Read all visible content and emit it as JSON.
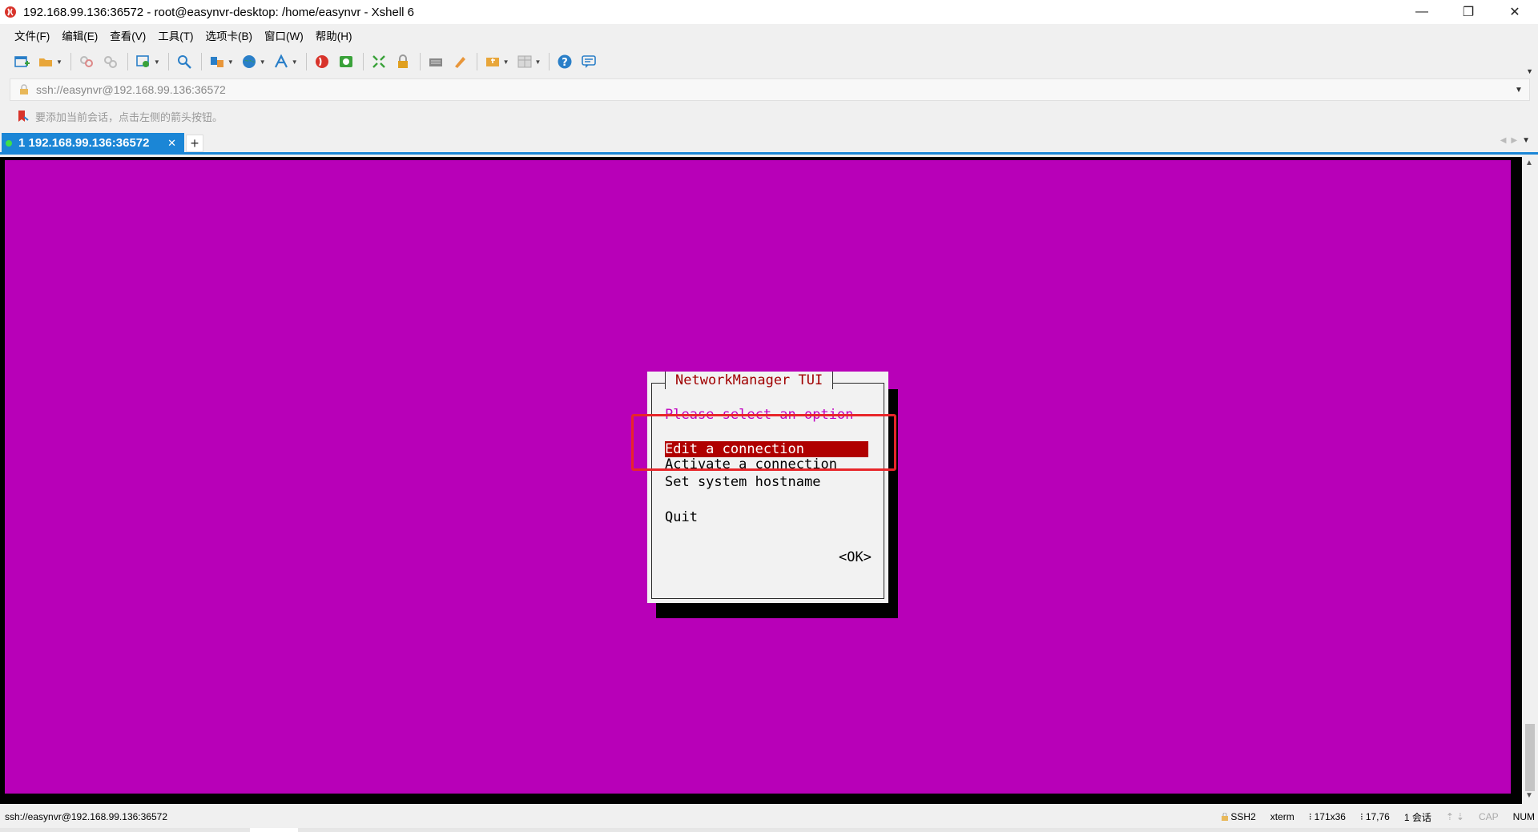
{
  "window": {
    "title": "192.168.99.136:36572 - root@easynvr-desktop: /home/easynvr - Xshell 6",
    "min_glyph": "—",
    "restore_glyph": "❐",
    "close_glyph": "✕"
  },
  "menu": {
    "items": [
      "文件(F)",
      "编辑(E)",
      "查看(V)",
      "工具(T)",
      "选项卡(B)",
      "窗口(W)",
      "帮助(H)"
    ]
  },
  "toolbar": {
    "icons": [
      "new-session-icon",
      "open-folder-icon",
      "connect-icon",
      "disconnect-icon",
      "properties-icon",
      "find-icon",
      "transfer-icon",
      "globe-icon",
      "font-icon",
      "xshell-icon",
      "xftp-icon",
      "fullscreen-icon",
      "lock-icon",
      "keyboard-icon",
      "compose-icon",
      "script-icon",
      "layout-icon",
      "help-icon",
      "chat-icon"
    ],
    "colors": {
      "blue": "#1b86d6",
      "green": "#3aa23a",
      "red": "#d8342b",
      "orange": "#e8963a"
    }
  },
  "address": {
    "value": "ssh://easynvr@192.168.99.136:36572"
  },
  "hint": {
    "text": "要添加当前会话，点击左侧的箭头按钮。"
  },
  "tabs": [
    {
      "label": "1 192.168.99.136:36572",
      "active": true
    }
  ],
  "tab_add_glyph": "+",
  "terminal": {
    "background": "#b800b8",
    "dialog": {
      "title": "NetworkManager TUI",
      "prompt": "Please select an option",
      "options": [
        "Edit a connection",
        "Activate a connection",
        "Set system hostname",
        "Quit"
      ],
      "selected_option": "Edit a connection",
      "ok_label": "<OK>"
    }
  },
  "statusbar": {
    "left": "ssh://easynvr@192.168.99.136:36572",
    "protocol": "SSH2",
    "terminal_type": "xterm",
    "size": "171x36",
    "cursor": "17,76",
    "sessions": "1 会话",
    "cap": "CAP",
    "num": "NUM"
  }
}
